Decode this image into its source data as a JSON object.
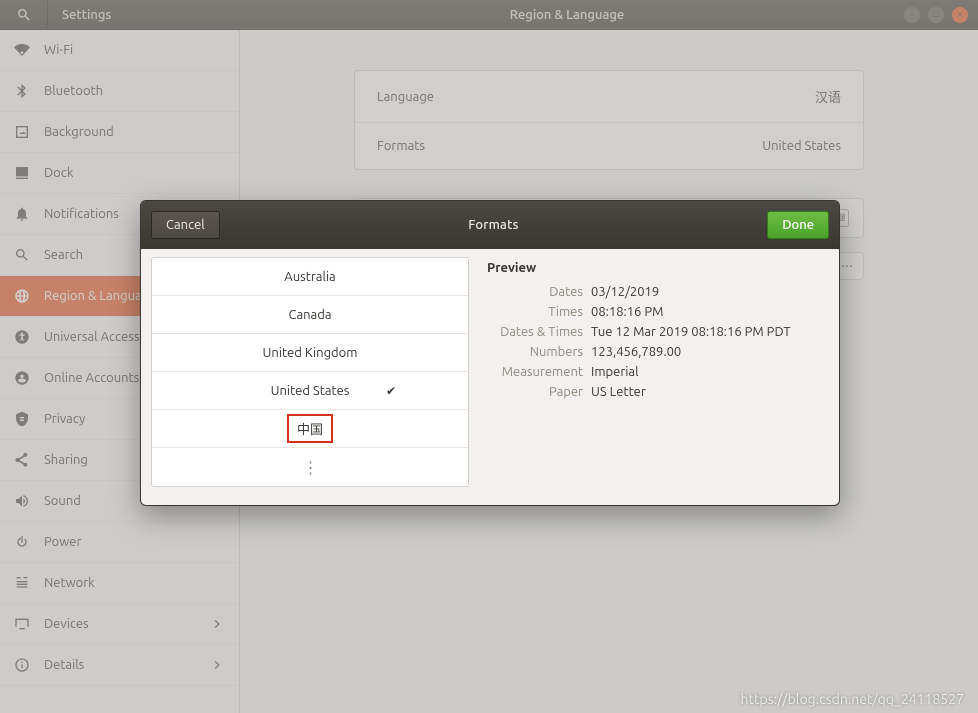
{
  "header": {
    "app_title": "Settings",
    "panel_title": "Region & Language"
  },
  "sidebar": {
    "items": [
      {
        "label": "Wi-Fi",
        "icon": "wifi-icon"
      },
      {
        "label": "Bluetooth",
        "icon": "bluetooth-icon"
      },
      {
        "label": "Background",
        "icon": "background-icon"
      },
      {
        "label": "Dock",
        "icon": "dock-icon"
      },
      {
        "label": "Notifications",
        "icon": "bell-icon"
      },
      {
        "label": "Search",
        "icon": "search-icon"
      },
      {
        "label": "Region & Language",
        "icon": "globe-icon",
        "active": true
      },
      {
        "label": "Universal Access",
        "icon": "accessibility-icon"
      },
      {
        "label": "Online Accounts",
        "icon": "online-accounts-icon"
      },
      {
        "label": "Privacy",
        "icon": "privacy-icon"
      },
      {
        "label": "Sharing",
        "icon": "sharing-icon"
      },
      {
        "label": "Sound",
        "icon": "sound-icon"
      },
      {
        "label": "Power",
        "icon": "power-icon"
      },
      {
        "label": "Network",
        "icon": "network-icon"
      },
      {
        "label": "Devices",
        "icon": "devices-icon",
        "chevron": true
      },
      {
        "label": "Details",
        "icon": "details-icon",
        "chevron": true
      }
    ]
  },
  "main": {
    "rows": [
      {
        "label": "Language",
        "value": "汉语"
      },
      {
        "label": "Formats",
        "value": "United States"
      }
    ]
  },
  "dialog": {
    "title": "Formats",
    "cancel": "Cancel",
    "done": "Done",
    "formats": [
      {
        "label": "Australia"
      },
      {
        "label": "Canada"
      },
      {
        "label": "United Kingdom"
      },
      {
        "label": "United States",
        "selected": true
      },
      {
        "label": "中国",
        "highlighted": true
      }
    ],
    "preview": {
      "title": "Preview",
      "rows": [
        {
          "label": "Dates",
          "value": "03/12/2019"
        },
        {
          "label": "Times",
          "value": "08:18:16 PM"
        },
        {
          "label": "Dates & Times",
          "value": "Tue 12 Mar 2019 08:18:16 PM PDT"
        },
        {
          "label": "Numbers",
          "value": "123,456,789.00"
        },
        {
          "label": "Measurement",
          "value": "Imperial"
        },
        {
          "label": "Paper",
          "value": "US Letter"
        }
      ]
    }
  },
  "watermark": "https://blog.csdn.net/qq_24118527"
}
